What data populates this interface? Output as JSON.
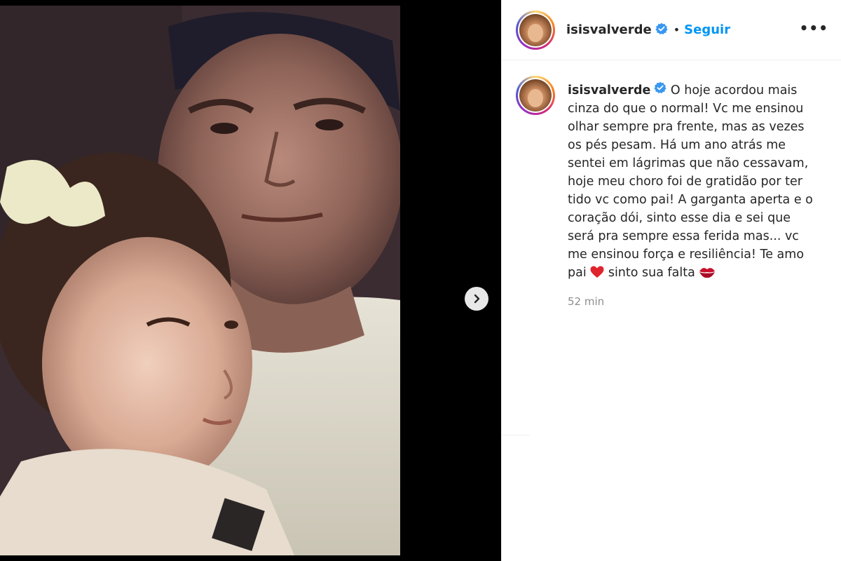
{
  "post": {
    "username": "isisvalverde",
    "follow_label": "Seguir",
    "dot": "•",
    "more_label": "•••",
    "caption_text": " O hoje acordou mais cinza do que o normal! Vc me ensinou olhar sempre pra frente, mas as vezes os pés pesam. Há um ano atrás me sentei em lágrimas que não cessavam, hoje meu choro foi de gratidão por ter tido vc como pai! A garganta aperta e o coração dói, sinto esse dia e sei que será pra sempre essa ferida mas... vc me ensinou força e resiliência! Te amo pai ",
    "caption_mid": " sinto sua falta ",
    "time": "52 min"
  },
  "icons": {
    "verified": "verified-badge-icon",
    "heart": "red-heart-icon",
    "lips": "kiss-mark-icon",
    "next": "chevron-right-icon",
    "more": "more-options-icon"
  },
  "colors": {
    "accent": "#0095f6",
    "verified": "#3897f0",
    "muted": "#8e8e8e"
  }
}
